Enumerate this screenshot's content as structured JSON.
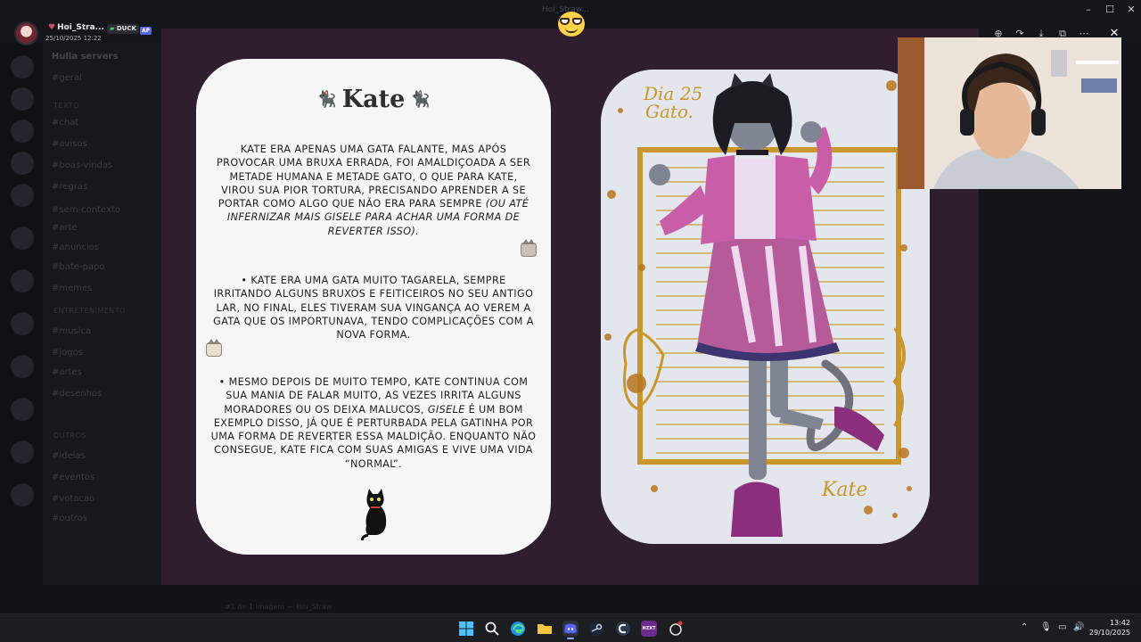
{
  "window": {
    "title": "Hoi_Straw..."
  },
  "user": {
    "name": "Hoi_Stra...",
    "timestamp": "25/10/2025 12:22",
    "badge_duck": "DUCK",
    "badge_ap": "AP"
  },
  "background": {
    "server_header": "Hulla servers",
    "channels": [
      "#geral",
      "#chat",
      "#avisos",
      "#boas-vindas",
      "#regras",
      "#sem-contexto",
      "#arte",
      "#anuncios",
      "#bate-papo",
      "#memes",
      "#musica",
      "#jogos",
      "#artes",
      "#desenhos",
      "#ideias",
      "#eventos",
      "#votacao",
      "#outros"
    ],
    "channel_heads": [
      "TEXTO",
      "ENTRETENIMENTO",
      "OUTROS"
    ],
    "bottom_text": "#1 de 1 imagem — Hoi_Straw"
  },
  "viewer": {
    "toolbar": [
      "zoom-in-icon",
      "forward-icon",
      "download-icon",
      "open-external-icon",
      "more-icon",
      "close-icon"
    ]
  },
  "card": {
    "title": "Kate",
    "p1_normal": "Kate era apenas uma gata falante, mas após provocar uma bruxa errada, foi amaldiçoada a ser metade humana e metade gato, o que para Kate, virou sua pior tortura, precisando aprender a se portar como algo que não era para sempre ",
    "p1_italic": "(ou até infernizar mais Gisele para achar uma forma de reverter isso).",
    "p2": "• Kate era uma gata muito tagarela, sempre irritando alguns bruxos e feiticeiros no seu antigo lar, no final, eles tiveram sua vingança ao verem a gata que os importunava, tendo complicações com a nova forma.",
    "p3_a": "• Mesmo depois de muito tempo, Kate continua com sua mania de falar muito, as vezes irrita alguns moradores ou os deixa malucos, ",
    "p3_italic": "Gisele",
    "p3_b": " é um bom exemplo disso, já que é perturbada pela gatinha por uma forma de reverter essa maldição. Enquanto não consegue, Kate fica com suas amigas e vive uma vida “normal”."
  },
  "artwork": {
    "caption_top_line1": "Dia 25",
    "caption_top_line2": "Gato.",
    "signature": "Kate"
  },
  "taskbar": {
    "time": "13:42",
    "date": "29/10/2025",
    "apps": [
      "windows-start-icon",
      "search-icon",
      "edge-icon",
      "file-explorer-icon",
      "discord-icon",
      "steam-icon",
      "ccleaner-icon",
      "nzxt-icon",
      "notification-app-icon"
    ]
  },
  "colors": {
    "stage_bg": "#2f1f2e",
    "card_bg": "#f6f6f6",
    "discord_blurple": "#5865f2",
    "accent_gold": "#c9962b",
    "dress_pink": "#b55b9a"
  }
}
